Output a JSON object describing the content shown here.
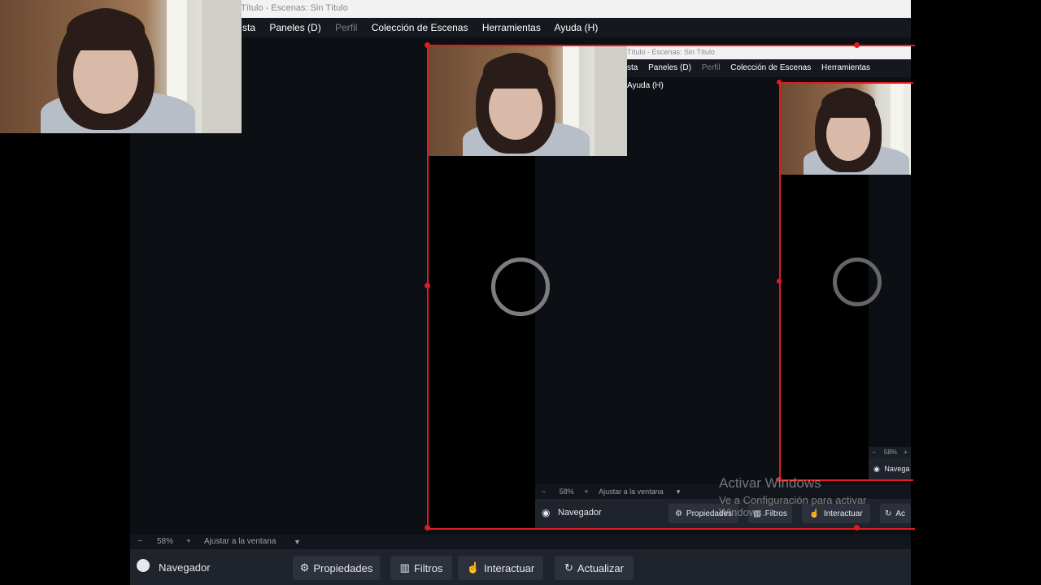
{
  "window": {
    "title": "Título - Escenas: Sin Título",
    "menu": [
      "sta",
      "Paneles (D)",
      "Perfil",
      "Colección de Escenas",
      "Herramientas",
      "Ayuda (H)"
    ]
  },
  "inner_window": {
    "title": "Título - Escenas: Sin Título",
    "menu": [
      "sta",
      "Paneles (D)",
      "Perfil",
      "Colección de Escenas",
      "Herramientas",
      "Ayuda (H)"
    ]
  },
  "zoom_bar": {
    "minus": "−",
    "zoom": "58%",
    "plus": "+",
    "fit": "Ajustar a la ventana"
  },
  "dock": {
    "source_label": "Navegador",
    "buttons": {
      "properties": "Propiedades",
      "filters": "Filtros",
      "interact": "Interactuar",
      "refresh": "Actualizar"
    }
  },
  "inner_dock": {
    "source_label": "Navegador",
    "buttons": {
      "properties": "Propiedades",
      "filters": "Filtros",
      "interact": "Interactuar",
      "refresh": "Ac"
    },
    "zoom": "58%",
    "fit": "Ajustar a la ventana"
  },
  "deep_dock": {
    "zoom": "58%",
    "source_label": "Navega"
  },
  "watermark": {
    "title": "Activar Windows",
    "line": "Ve a Configuración para activar",
    "line2": "Windows."
  },
  "colors": {
    "selection": "#e21b1b",
    "preview_bg": "#0c0f14",
    "dock_bg": "#1f232b"
  }
}
